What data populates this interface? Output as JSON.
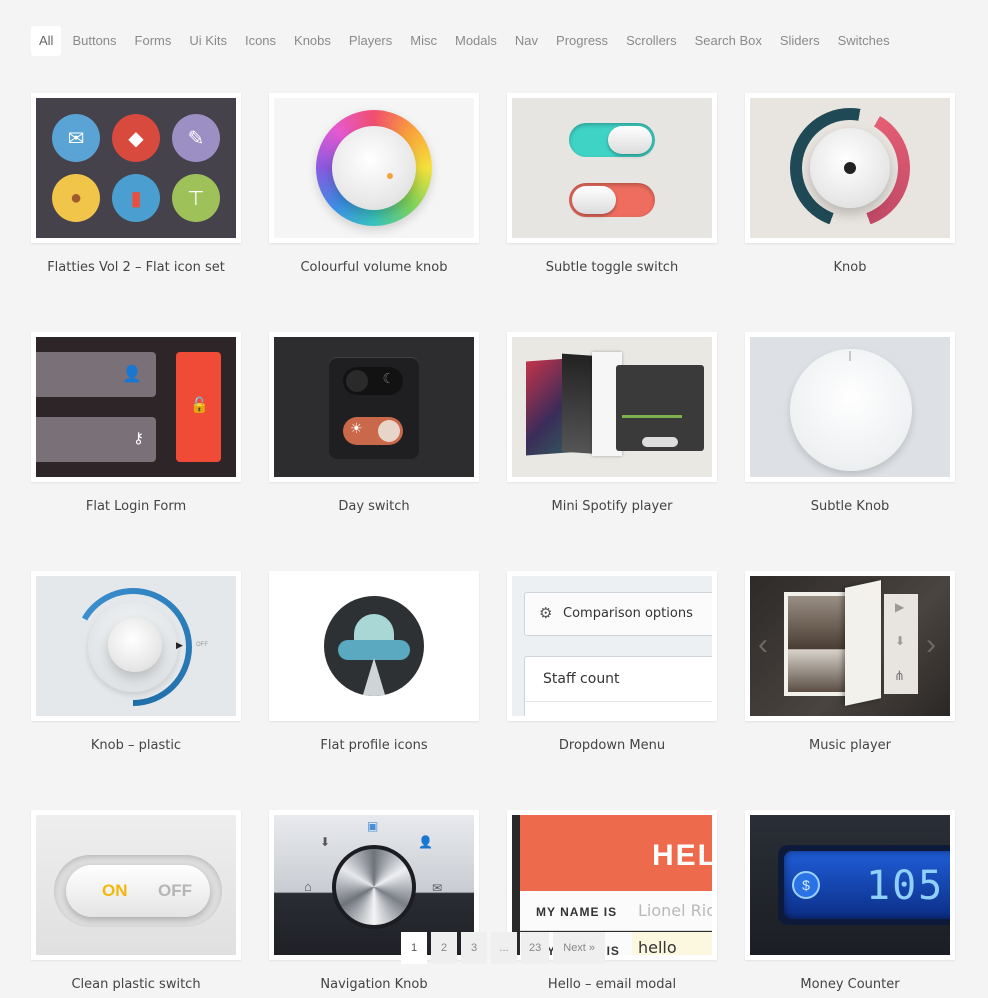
{
  "filters": [
    "All",
    "Buttons",
    "Forms",
    "Ui Kits",
    "Icons",
    "Knobs",
    "Players",
    "Misc",
    "Modals",
    "Nav",
    "Progress",
    "Scrollers",
    "Search Box",
    "Sliders",
    "Switches"
  ],
  "active_filter": "All",
  "items": [
    {
      "title": "Flatties Vol 2 – Flat icon set"
    },
    {
      "title": "Colourful volume knob"
    },
    {
      "title": "Subtle toggle switch"
    },
    {
      "title": "Knob"
    },
    {
      "title": "Flat Login Form"
    },
    {
      "title": "Day switch"
    },
    {
      "title": "Mini Spotify player"
    },
    {
      "title": "Subtle Knob"
    },
    {
      "title": "Knob – plastic"
    },
    {
      "title": "Flat profile icons"
    },
    {
      "title": "Dropdown Menu"
    },
    {
      "title": "Music player"
    },
    {
      "title": "Clean plastic switch"
    },
    {
      "title": "Navigation Knob"
    },
    {
      "title": "Hello – email modal"
    },
    {
      "title": "Money Counter"
    }
  ],
  "thumb_text": {
    "off_label": "OFF",
    "dropdown_option": "Comparison options",
    "dropdown_item": "Staff count",
    "switch_on": "ON",
    "switch_off": "OFF",
    "hello_banner": "HEL",
    "name_label": "MY NAME IS",
    "name_value": "Lionel Ric",
    "email_label": "MY EMAIL IS",
    "email_value": "hello",
    "counter_value": "105",
    "counter_symbol": "$"
  },
  "pagination": {
    "pages": [
      "1",
      "2",
      "3",
      "...",
      "23"
    ],
    "next": "Next »",
    "current": "1"
  },
  "colors": {
    "background": "#f4f4f4",
    "flat_red": "#ef4b36",
    "teal": "#3fd3c6",
    "coral": "#ee6d5e"
  }
}
